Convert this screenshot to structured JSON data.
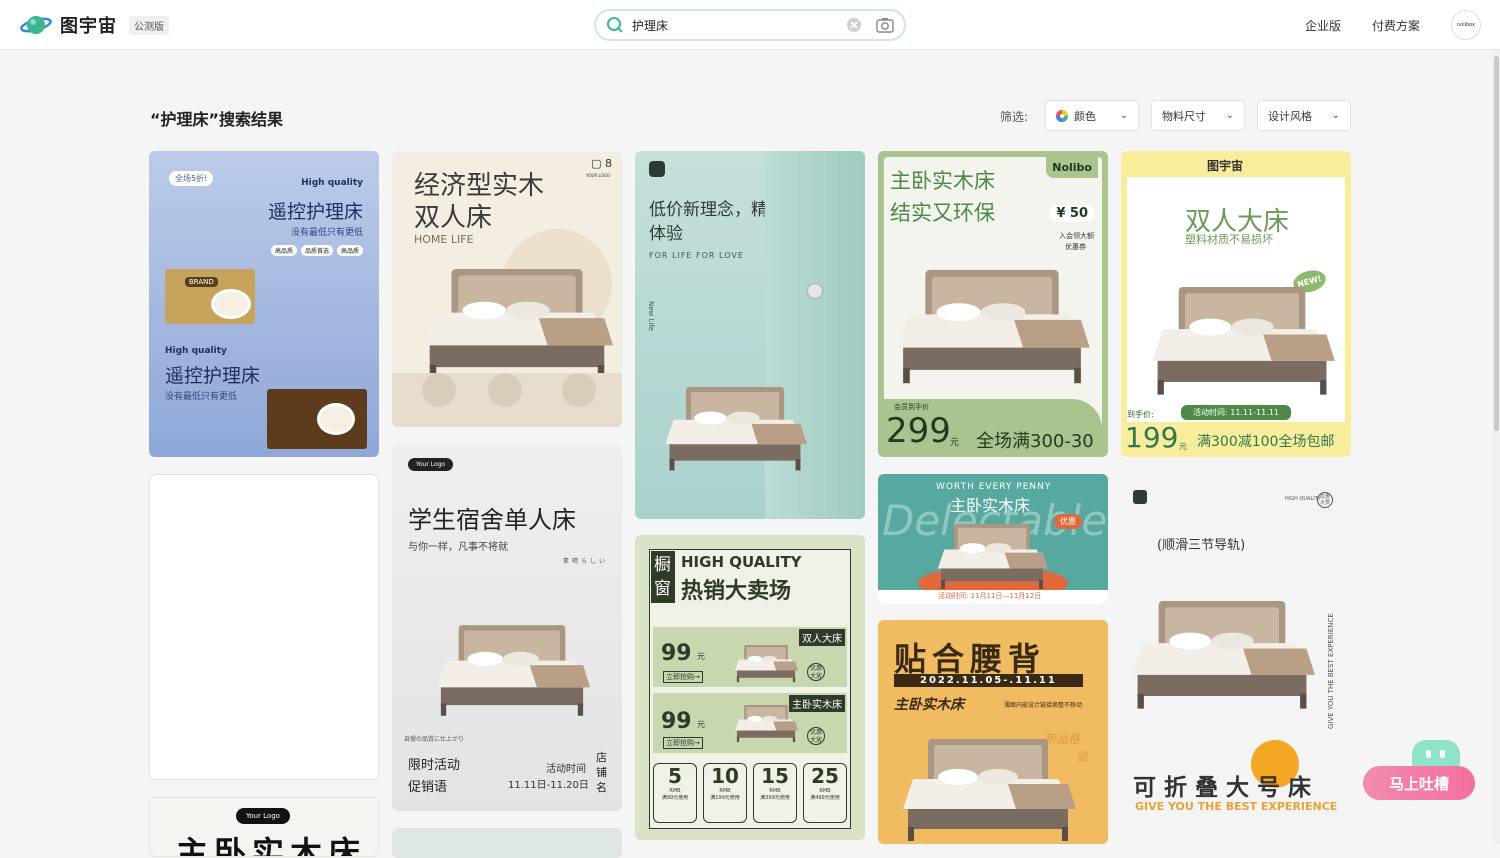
{
  "header": {
    "logo_text": "图宇宙",
    "beta_badge": "公测版",
    "search_value": "护理床",
    "nav": [
      "企业版",
      "付费方案"
    ],
    "avatar_text": "nolibox"
  },
  "results": {
    "title": "“护理床”搜索结果",
    "filter_label": "筛选:",
    "filters": [
      "颜色",
      "物料尺寸",
      "设计风格"
    ]
  },
  "cards": {
    "c1": {
      "badge": "全场5折!",
      "hq1": "High quality",
      "title1": "遥控护理床",
      "sub1": "没有最低只有更低",
      "tags": [
        "高品质",
        "品质首选",
        "高品质"
      ],
      "hq2": "High quality",
      "title2": "遥控护理床",
      "sub2": "没有最低只有更低",
      "brand": "BRAND"
    },
    "c2": {
      "page_count": "8",
      "title1": "经济型实木",
      "title2": "双人床",
      "sub": "HOME LIFE",
      "logo": "YOUR LOGO"
    },
    "c3": {
      "title1": "低价新理念，精品新",
      "title2": "体验",
      "sub": "FOR LIFE FOR LOVE",
      "vertical": "New Life"
    },
    "c4": {
      "title1": "主卧实木床",
      "title2": "结实又环保",
      "brand": "Nolibo",
      "coupon": "¥ 50",
      "coupon_note1": "入会领大额",
      "coupon_note2": "优惠券",
      "member": "会员到手价",
      "price": "299",
      "unit": "元",
      "promo": "全场满300-30"
    },
    "c5": {
      "brand": "图宇宙",
      "title": "双人大床",
      "sub": "塑料材质不易损坏",
      "badge": "NEW!",
      "price_label": "到手价:",
      "time": "活动时间: 11.11-11.11",
      "price": "199",
      "unit": "元",
      "promo": "满300减100全场包邮"
    },
    "c7": {
      "logo": "Your Logo",
      "title": "学生宿舍单人床",
      "sub": "与你一样，凡事不将就",
      "jp": "素晴らしい",
      "jp2": "自慢の品質に仕上がり",
      "promo1": "限时活动",
      "promo2": "促销语",
      "time_label": "活动时间",
      "time": "11.11日-11.20日",
      "store": "店铺名"
    },
    "c8": {
      "hq": "HIGH QUALITY",
      "title": "热销大卖场",
      "side": "橱窗",
      "p1_label": "双人大床",
      "p1_price": "99",
      "p2_label": "主卧实木床",
      "p2_price": "99",
      "unit": "元",
      "buy": "立即抢购→",
      "coupon": "优惠大放",
      "tiers": [
        "5",
        "10",
        "15",
        "25"
      ],
      "tier_rmb": "RMB",
      "tier_notes": [
        "满99元使用",
        "满199元使用",
        "满399元使用",
        "满499元使用"
      ]
    },
    "c9": {
      "top": "WORTH EVERY PENNY",
      "title": "主卧实木床",
      "deco": "Delectable",
      "tag": "优惠",
      "footer": "活动时间: 11月11日—11月12日"
    },
    "c10": {
      "hq": "HIGH QUALITY",
      "badge": "优惠大赏",
      "sub": "(顺滑三节导轨)",
      "vertical": "GIVE YOU THE BEST EXPERIENCE",
      "title": "可折叠大号床",
      "tagline": "GIVE YOU THE BEST EXPERIENCE"
    },
    "c11": {
      "title": "贴合腰背",
      "date": "2022.11.05-.11.11",
      "sub": "主卧实木床",
      "note": "薄面内嵌设计链接换整不移动",
      "v1": "新品格",
      "v2": "验"
    },
    "c12": {
      "logo": "Your Logo",
      "title": "主卧实木床"
    }
  },
  "feedback": "马上吐槽",
  "colors": {
    "accent": "#3cb48f",
    "feedback": "#f46fa0",
    "green_dark": "#2f7a4d"
  }
}
